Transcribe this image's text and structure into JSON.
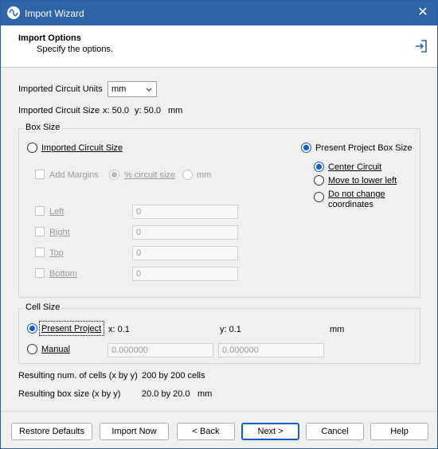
{
  "window": {
    "title": "Import Wizard",
    "close_glyph": "✕"
  },
  "header": {
    "title": "Import Options",
    "subtitle": "Specify the options."
  },
  "units": {
    "label": "Imported Circuit Units",
    "value": "mm"
  },
  "size_line": {
    "label": "Imported Circuit Size",
    "x": "x: 50.0",
    "y": "y: 50.0",
    "unit": "mm"
  },
  "box_size": {
    "group_label": "Box Size",
    "imported_label": "Imported Circuit Size",
    "present_label": "Present Project Box Size",
    "add_margins_label": "Add Margins",
    "percent_label": "% circuit size",
    "mm_label": "mm",
    "margins": [
      {
        "label": "Left",
        "value": "0"
      },
      {
        "label": "Right",
        "value": "0"
      },
      {
        "label": "Top",
        "value": "0"
      },
      {
        "label": "Bottom",
        "value": "0"
      }
    ],
    "center_label": "Center Circuit",
    "lower_left_label": "Move to lower left",
    "no_change_label_1": "Do not change",
    "no_change_label_2": "coordinates"
  },
  "cell_size": {
    "group_label": "Cell Size",
    "present_label": "Present Project",
    "x_text": "x: 0.1",
    "y_text": "y: 0.1",
    "unit": "mm",
    "manual_label": "Manual",
    "manual_x": "0.000000",
    "manual_y": "0.000000"
  },
  "results": {
    "cells_label": "Resulting num. of cells (x by y)",
    "cells_value": "200 by 200 cells",
    "box_label": "Resulting box size (x by y)",
    "box_value": "20.0 by 20.0",
    "box_unit": "mm"
  },
  "buttons": {
    "restore": "Restore Defaults",
    "import": "Import Now",
    "back": "< Back",
    "next": "Next >",
    "cancel": "Cancel",
    "help": "Help"
  },
  "colors": {
    "titlebar": "#2f64a8",
    "accent": "#0a5fc8"
  },
  "icons": {
    "app": "app-wave-icon",
    "close": "close-icon",
    "export": "export-icon"
  }
}
